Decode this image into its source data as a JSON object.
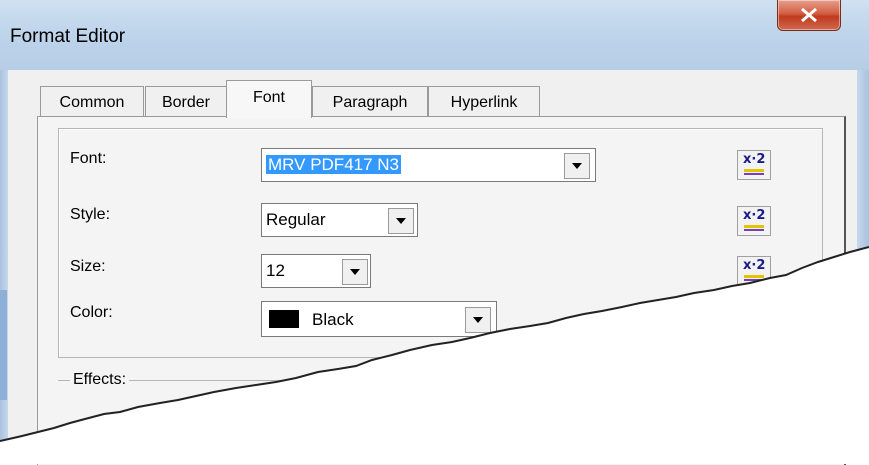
{
  "window": {
    "title": "Format Editor"
  },
  "tabs": [
    {
      "label": "Common"
    },
    {
      "label": "Border"
    },
    {
      "label": "Font"
    },
    {
      "label": "Paragraph"
    },
    {
      "label": "Hyperlink"
    }
  ],
  "font_panel": {
    "font": {
      "label": "Font:",
      "value": "MRV PDF417 N3"
    },
    "style": {
      "label": "Style:",
      "value": "Regular"
    },
    "size": {
      "label": "Size:",
      "value": "12"
    },
    "color": {
      "label": "Color:",
      "value": "Black",
      "swatch": "#000000"
    },
    "reset_icon": "x2-reset-icon"
  },
  "effects": {
    "label": "Effects:"
  },
  "colors": {
    "selection": "#3399ff",
    "close_button": "#c9462c",
    "title_bar": "#bcd3ea"
  }
}
